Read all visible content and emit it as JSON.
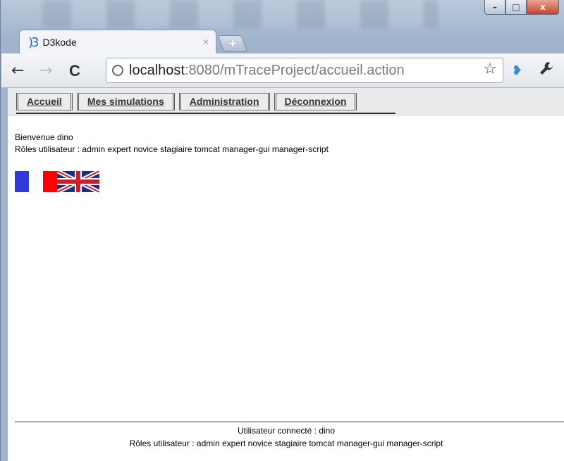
{
  "browser": {
    "tab": {
      "title": "D3kode",
      "close_glyph": "×",
      "favicon": "d3kode-logo-icon"
    },
    "new_tab_glyph": "+",
    "window_controls": {
      "minimize": "–",
      "maximize": "□",
      "close": "x"
    },
    "nav": {
      "back": "←",
      "forward": "→",
      "reload": "C"
    },
    "omnibox": {
      "host": "localhost",
      "path": ":8080/mTraceProject/accueil.action"
    },
    "star": "☆",
    "extension": "❥",
    "wrench": "🔧"
  },
  "menu": {
    "items": [
      {
        "label": "Accueil"
      },
      {
        "label": "Mes simulations"
      },
      {
        "label": "Administration"
      },
      {
        "label": "Déconnexion"
      }
    ]
  },
  "content": {
    "welcome": "Bienvenue dino",
    "roles": "Rôles utilisateur : admin expert novice stagiaire tomcat manager-gui manager-script"
  },
  "flags": {
    "fr_colors": [
      "#2e3bd6",
      "#ffffff",
      "#ff0000"
    ],
    "uk_colors": {
      "blue": "#1a2f86",
      "red": "#d11b2a",
      "white": "#ffffff"
    }
  },
  "footer": {
    "connected": "Utilisateur connecté : dino",
    "roles": "Rôles utilisateur : admin expert novice stagiaire tomcat manager-gui manager-script"
  }
}
